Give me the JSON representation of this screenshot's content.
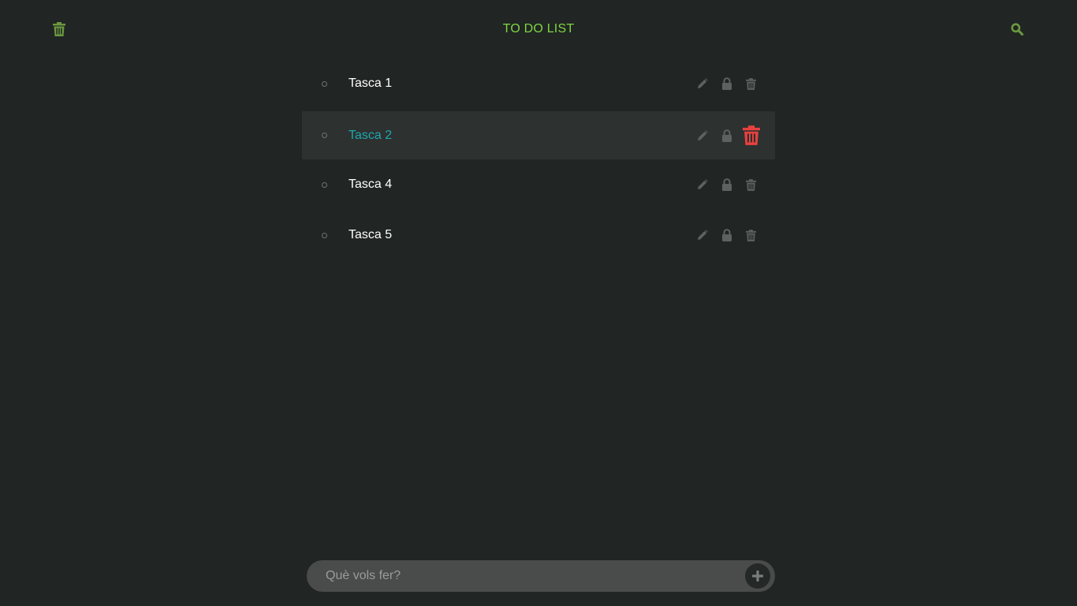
{
  "header": {
    "title": "TO DO LIST",
    "left_icon": "trash-icon",
    "right_icon": "search-icon"
  },
  "tasks": [
    {
      "label": "Tasca 1",
      "active": false
    },
    {
      "label": "Tasca 2",
      "active": true
    },
    {
      "label": "Tasca 4",
      "active": false
    },
    {
      "label": "Tasca 5",
      "active": false
    }
  ],
  "task_action_icons": [
    "pencil-icon",
    "lock-icon",
    "trash-icon"
  ],
  "composer": {
    "placeholder": "Què vols fer?",
    "value": "",
    "add_icon": "plus-icon"
  },
  "colors": {
    "background": "#212524",
    "accent_green": "#7fd641",
    "icon_green": "#6b9a3e",
    "active_row": "#2d3130",
    "active_text": "#1fa8ad",
    "delete_red": "#e8413f",
    "muted_icon": "#5d615f"
  }
}
